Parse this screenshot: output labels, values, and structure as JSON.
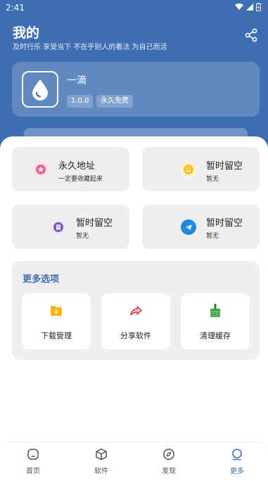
{
  "status_bar": {
    "time": "2:41"
  },
  "header": {
    "title": "我的",
    "subtitle": "及时行乐 享受当下 不在乎别人的看法 为自己而活"
  },
  "profile": {
    "app_name": "一滴",
    "version": "1.0.0",
    "license": "永久免费"
  },
  "grid": [
    {
      "title": "永久地址",
      "subtitle": "一定要收藏起来",
      "icon": "star-icon",
      "color": "#f06292"
    },
    {
      "title": "暂时留空",
      "subtitle": "暂无",
      "icon": "smile-icon",
      "color": "#fbc02d"
    },
    {
      "title": "暂时留空",
      "subtitle": "暂无",
      "icon": "document-icon",
      "color": "#7e57c2"
    },
    {
      "title": "暂时留空",
      "subtitle": "暂无",
      "icon": "telegram-icon",
      "color": "#1e88e5"
    }
  ],
  "more": {
    "title": "更多选项",
    "items": [
      {
        "label": "下载管理",
        "icon": "download-folder-icon",
        "color": "#ffb300"
      },
      {
        "label": "分享软件",
        "icon": "share-arrow-icon",
        "color": "#e57373"
      },
      {
        "label": "清理缓存",
        "icon": "broom-icon",
        "color": "#43a047"
      }
    ]
  },
  "bottom_nav": [
    {
      "label": "首页",
      "icon": "home-icon",
      "active": false
    },
    {
      "label": "软件",
      "icon": "box-icon",
      "active": false
    },
    {
      "label": "发现",
      "icon": "compass-icon",
      "active": false
    },
    {
      "label": "更多",
      "icon": "profile-icon",
      "active": true
    }
  ],
  "colors": {
    "primary": "#3f6eb4",
    "card": "#efefef"
  }
}
